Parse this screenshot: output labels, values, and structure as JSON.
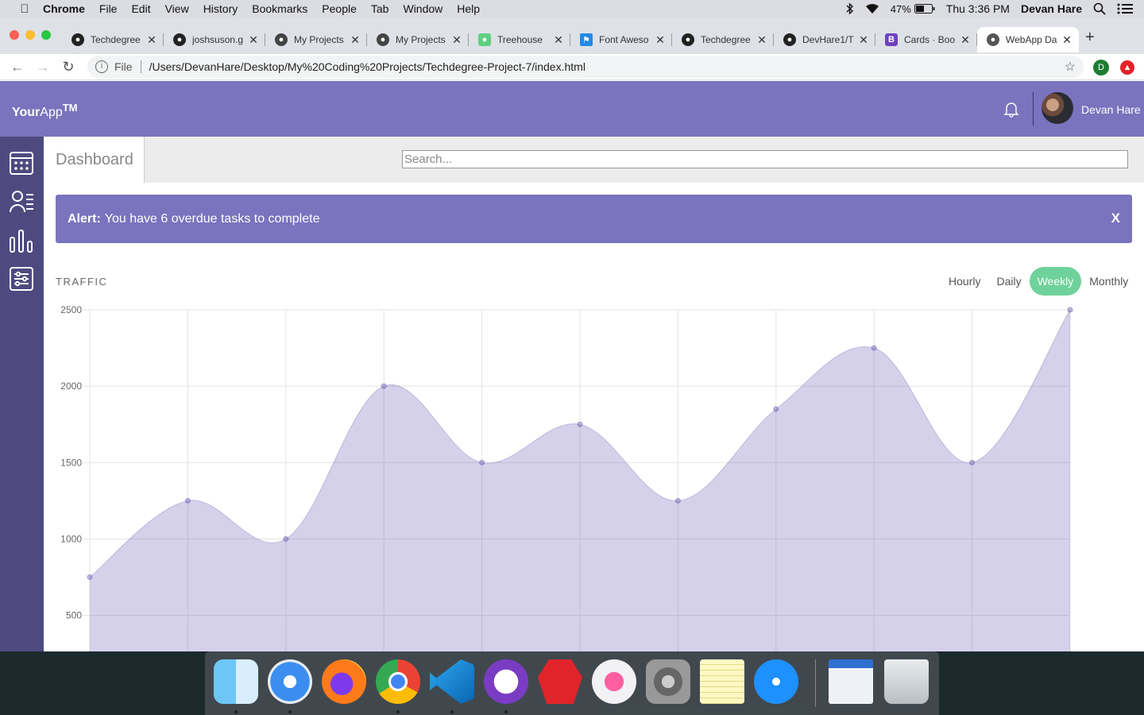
{
  "menubar": {
    "app": "Chrome",
    "items": [
      "File",
      "Edit",
      "View",
      "History",
      "Bookmarks",
      "People",
      "Tab",
      "Window",
      "Help"
    ],
    "battery": "47%",
    "clock": "Thu 3:36 PM",
    "user": "Devan Hare"
  },
  "browser": {
    "tabs": [
      {
        "title": "Techdegree",
        "icon": "github-icon"
      },
      {
        "title": "joshsuson.g",
        "icon": "github-icon"
      },
      {
        "title": "My Projects",
        "icon": "globe-icon"
      },
      {
        "title": "My Projects",
        "icon": "globe-icon"
      },
      {
        "title": "Treehouse",
        "icon": "treehouse-icon"
      },
      {
        "title": "Font Aweso",
        "icon": "flag-icon"
      },
      {
        "title": "Techdegree",
        "icon": "github-icon"
      },
      {
        "title": "DevHare1/T",
        "icon": "github-icon"
      },
      {
        "title": "Cards · Boo",
        "icon": "bootstrap-icon"
      },
      {
        "title": "WebApp Da",
        "icon": "globe-icon"
      }
    ],
    "close_glyph": "✕",
    "scheme": "File",
    "url": "/Users/DevanHare/Desktop/My%20Coding%20Projects/Techdegree-Project-7/index.html",
    "profile_initial": "D"
  },
  "app": {
    "logo_bold": "Your",
    "logo_rest": "App",
    "logo_sup": "TM",
    "username": "Devan Hare",
    "page_tab": "Dashboard",
    "search_placeholder": "Search...",
    "alert": {
      "label": "Alert:",
      "message": "You have 6 overdue tasks to complete",
      "close": "X"
    },
    "traffic": {
      "title": "TRAFFIC",
      "ranges": [
        "Hourly",
        "Daily",
        "Weekly",
        "Monthly"
      ],
      "active_range": "Weekly"
    }
  },
  "colors": {
    "header": "#7a73bd",
    "sidebar": "#4e4a80",
    "active_pill": "#6fd19b",
    "chart_fill": "rgba(116,103,185,0.3)"
  },
  "chart_data": {
    "type": "area",
    "title": "",
    "xlabel": "",
    "ylabel": "",
    "x": [
      0,
      1,
      2,
      3,
      4,
      5,
      6,
      7,
      8,
      9,
      10
    ],
    "values": [
      750,
      1250,
      1000,
      2000,
      1500,
      1750,
      1250,
      1850,
      2250,
      1500,
      2500
    ],
    "yticks": [
      500,
      1000,
      1500,
      2000,
      2500
    ],
    "ylim": [
      0,
      2500
    ],
    "grid": true,
    "smooth": true
  },
  "dock": {
    "apps": [
      "finder-icon",
      "safari-icon",
      "firefox-icon",
      "chrome-icon",
      "vscode-icon",
      "github-desktop-icon",
      "brave-icon",
      "music-icon",
      "system-preferences-icon",
      "notes-icon",
      "app-store-icon",
      "screenshot-icon",
      "trash-icon"
    ]
  }
}
